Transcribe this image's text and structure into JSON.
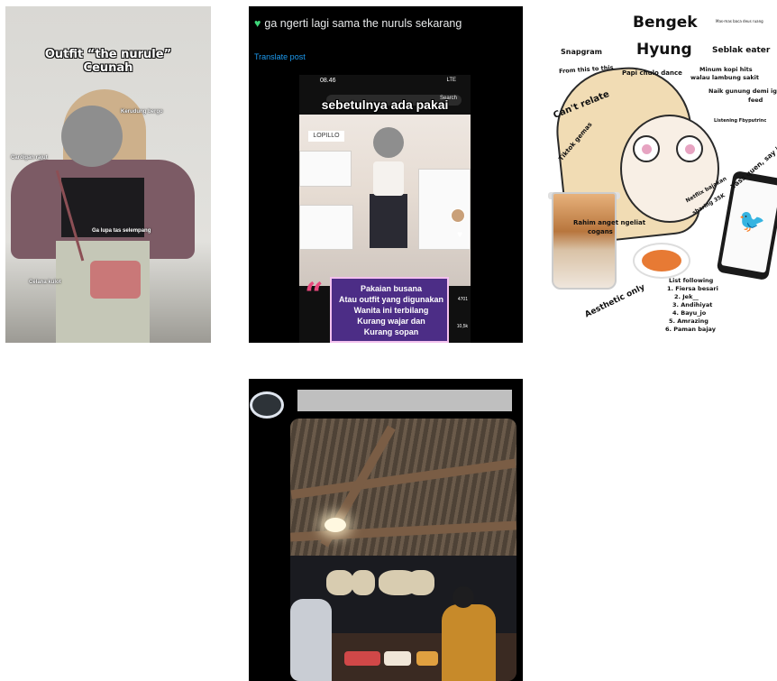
{
  "panel1": {
    "title_line1": "Outfit “the nurule”",
    "title_line2": "Ceunah",
    "labels": {
      "kerudung": "Kerudung bergo",
      "cardigan": "Cardigan rajut",
      "lupa": "Ga lupa tas selempang",
      "celana": "Celana kulot"
    }
  },
  "panel2": {
    "header": "ga ngerti lagi sama the nuruls sekarang",
    "translate": "Translate post",
    "status_time": "08.46",
    "status_icons": "LTE",
    "search_button": "Search",
    "overlay": "sebetulnya ada pakai",
    "store_sign": "LOPILLO",
    "caption": {
      "line1": "Pakaian busana",
      "line2": "Atau outfit yang digunakan",
      "line3": "Wanita ini terbilang",
      "line4": "Kurang wajar dan",
      "line5": "Kurang sopan"
    },
    "counts": [
      "4701",
      "10,5k"
    ]
  },
  "panel3": {
    "bengek": "Bengek",
    "hyung": "Hyung",
    "small_note": "Mas-mas baca deus ruang",
    "seblak": "Seblak eater",
    "snapgram": "Snapgram",
    "from_this": "From this to this",
    "papi": "Papi chulo dance",
    "minum": "Minum kopi hits",
    "walau": "walau lambung sakit",
    "cant_relate": "Can't relate",
    "naik_gunung": "Naik gunung demi ig",
    "feed": "feed",
    "tiktok": "Tiktok gemas",
    "listening": "Listening Fbyputrinc",
    "yass": "Yass quen, say it louder",
    "netflix": "Netflix bajakan",
    "sharing": "sharing 35K",
    "rahim": "Rahim anget ngeliat",
    "cogans": "cogans",
    "aesthetic": "Aesthetic only",
    "list_title": "List following",
    "list": [
      "1. Fiersa besari",
      "2. Jek__",
      "3. Andihiyat",
      "4. Bayu_jo",
      "5. Amrazing",
      "6. Paman bajay"
    ]
  },
  "panel4": {}
}
